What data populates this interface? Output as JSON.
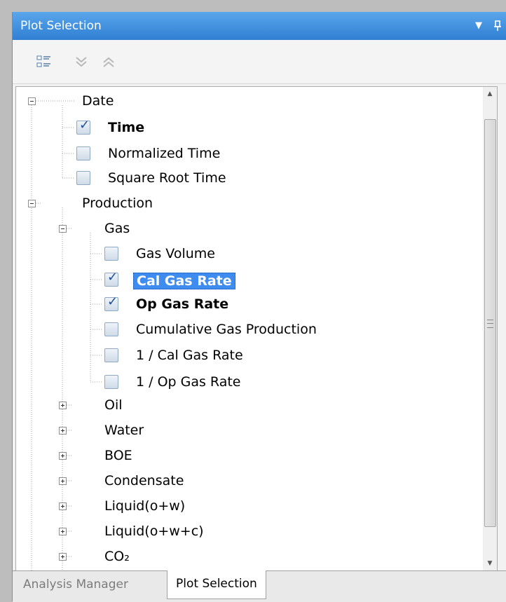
{
  "panel": {
    "title": "Plot Selection",
    "dropdown_icon": "▼",
    "pin_icon": "♇"
  },
  "toolbar": {
    "buttons": [
      "list-view-icon",
      "expand-all-icon",
      "collapse-all-icon"
    ]
  },
  "tree": {
    "date": {
      "label": "Date",
      "children": [
        {
          "label": "Time",
          "checked": true
        },
        {
          "label": "Normalized Time",
          "checked": false
        },
        {
          "label": "Square Root Time",
          "checked": false
        }
      ]
    },
    "production": {
      "label": "Production",
      "gas": {
        "label": "Gas",
        "children": [
          {
            "label": "Gas Volume",
            "checked": false
          },
          {
            "label": "Cal Gas Rate",
            "checked": true,
            "selected": true
          },
          {
            "label": "Op Gas Rate",
            "checked": true
          },
          {
            "label": "Cumulative Gas Production",
            "checked": false
          },
          {
            "label": "1 / Cal Gas Rate",
            "checked": false
          },
          {
            "label": "1 / Op Gas Rate",
            "checked": false
          }
        ]
      },
      "groups": [
        {
          "label": "Oil"
        },
        {
          "label": "Water"
        },
        {
          "label": "BOE"
        },
        {
          "label": "Condensate"
        },
        {
          "label": "Liquid(o+w)"
        },
        {
          "label": "Liquid(o+w+c)"
        },
        {
          "label": "CO₂"
        }
      ]
    }
  },
  "tabs": [
    {
      "label": "Analysis Manager",
      "active": false
    },
    {
      "label": "Plot Selection",
      "active": true
    }
  ]
}
